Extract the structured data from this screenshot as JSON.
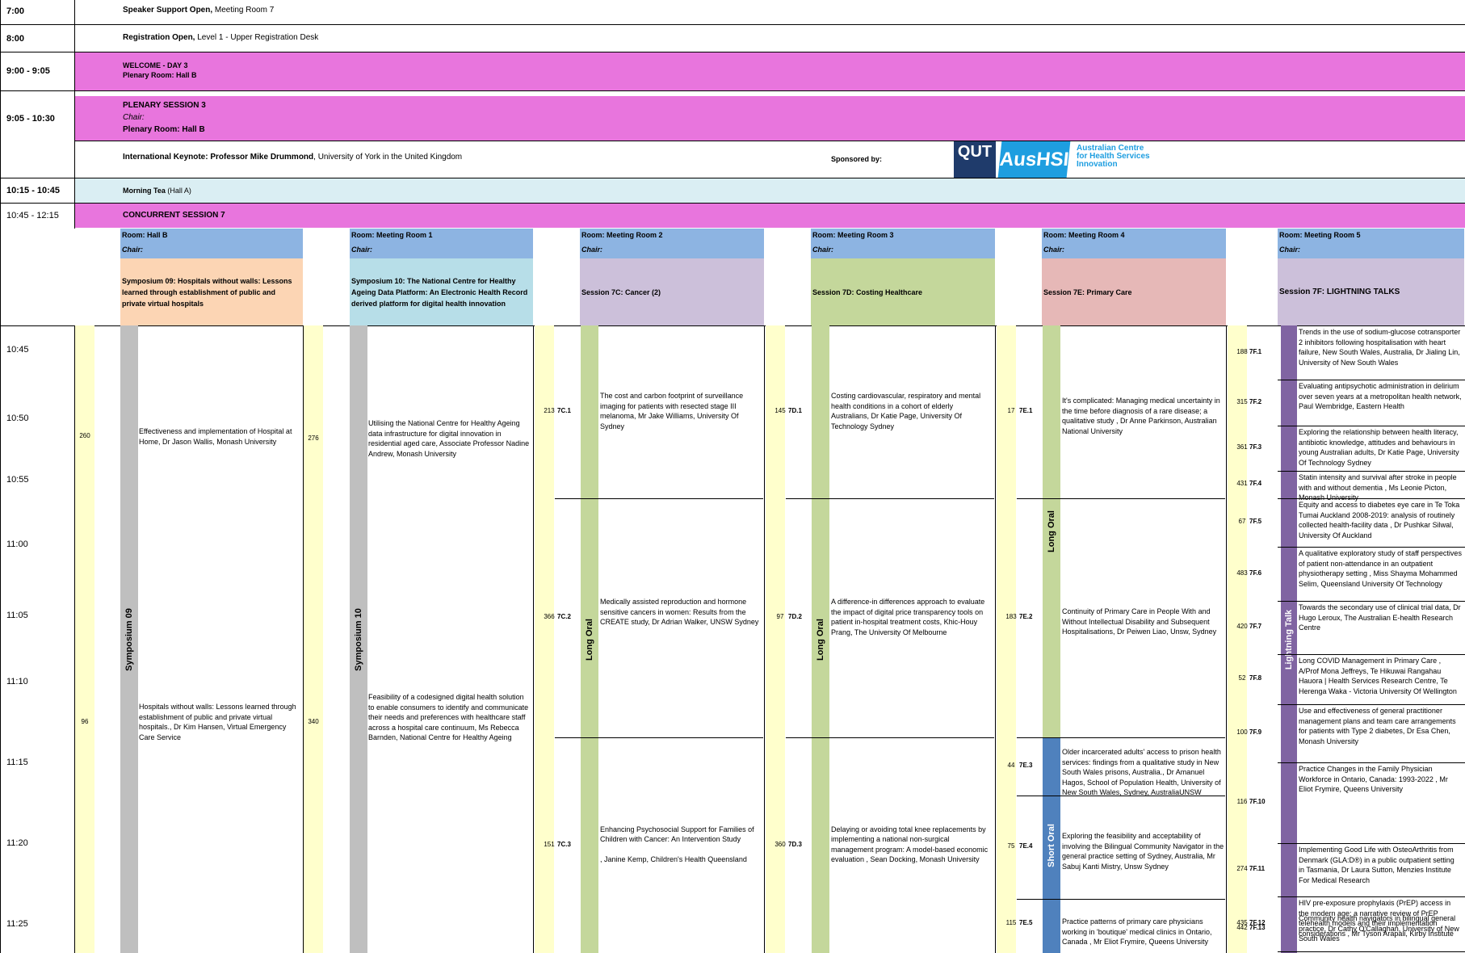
{
  "top_rows": [
    {
      "time": "7:00",
      "bold": "Speaker Support Open,",
      "rest": " Meeting Room 7"
    },
    {
      "time": "8:00",
      "bold": "Registration Open,",
      "rest": " Level 1 - Upper Registration Desk"
    }
  ],
  "welcome": {
    "time": "9:00 - 9:05",
    "line1": "WELCOME - DAY 3",
    "line2": "Plenary Room: Hall B"
  },
  "plenary": {
    "time": "9:05 - 10:30",
    "title": "PLENARY SESSION 3",
    "chair": "Chair:",
    "room": "Plenary Room: Hall B"
  },
  "keynote": {
    "bold": "International Keynote: Professor Mike Drummond",
    "rest": ", University of York in the United Kingdom",
    "sponsored": "Sponsored by:",
    "logo_qut": "QUT",
    "logo_ausxhsi": "AusHSI",
    "logo_text": [
      "Australian Centre",
      "for Health Services",
      "Innovation"
    ]
  },
  "morning_tea": {
    "time": "10:15 - 10:45",
    "bold": "Morning Tea",
    "rest": " (Hall A)"
  },
  "concurrent": {
    "time": "10:45 - 12:15",
    "title": "CONCURRENT SESSION 7"
  },
  "rooms": [
    {
      "room": "Room: Hall B",
      "chair": "Chair:",
      "session": "Symposium 09: Hospitals without walls: Lessons learned through establishment of public and private virtual hospitals",
      "color": "#fcd5b4"
    },
    {
      "room": "Room: Meeting Room 1",
      "chair": "Chair:",
      "session": "Symposium 10: The National Centre for Healthy Ageing Data Platform: An Electronic Health Record derived platform for digital health innovation",
      "color": "#b7dee8"
    },
    {
      "room": "Room: Meeting Room 2",
      "chair": "Chair:",
      "session": "Session 7C: Cancer (2)",
      "color": "#ccc0da"
    },
    {
      "room": "Room: Meeting Room 3",
      "chair": "Chair:",
      "session": "Session 7D: Costing Healthcare",
      "color": "#c4d79b"
    },
    {
      "room": "Room: Meeting Room 4",
      "chair": "Chair:",
      "session": "Session 7E: Primary Care",
      "color": "#e6b8b7"
    },
    {
      "room": "Room: Meeting Room 5",
      "chair": "Chair:",
      "session": "Session 7F: LIGHTNING TALKS",
      "color": "#ccc0da"
    }
  ],
  "room_header_color": "#8db4e2",
  "times": [
    "10:45",
    "10:50",
    "10:55",
    "11:00",
    "11:05",
    "11:10",
    "11:15",
    "11:20",
    "11:25"
  ],
  "vlabels": {
    "sym09": "Symposium 09",
    "sym10": "Symposium 10",
    "long_oral": "Long Oral",
    "short_oral": "Short Oral",
    "lightning": "Lightning Talk"
  },
  "sym09": [
    {
      "num": "260",
      "text": "Effectiveness and implementation of Hospital at Home, Dr Jason Wallis, Monash University"
    },
    {
      "num": "96",
      "text": "Hospitals without walls: Lessons learned through establishment of public and private virtual hospitals., Dr Kim Hansen, Virtual Emergency Care Service"
    }
  ],
  "sym10": [
    {
      "num": "276",
      "text": "Utilising the National Centre for Healthy Ageing data infrastructure for digital innovation in residential aged care, Associate Professor Nadine Andrew, Monash University"
    },
    {
      "num": "340",
      "text": "Feasibility of a codesigned digital health solution to enable consumers to identify and communicate their needs and preferences with healthcare staff across a hospital care continuum, Ms Rebecca Barnden, National Centre for Healthy Ageing"
    }
  ],
  "c7": [
    {
      "num": "213",
      "code": "7C.1",
      "text": "The cost and carbon footprint of surveillance imaging for patients with resected stage III melanoma, Mr Jake Williams, University Of Sydney"
    },
    {
      "num": "366",
      "code": "7C.2",
      "text": "Medically assisted reproduction and hormone sensitive cancers in women: Results from the CREATE study, Dr Adrian Walker, UNSW Sydney"
    },
    {
      "num": "151",
      "code": "7C.3",
      "text": "Enhancing Psychosocial Support for Families of Children with Cancer: An Intervention Study\n\n, Janine Kemp, Children's Health Queensland"
    }
  ],
  "d7": [
    {
      "num": "145",
      "code": "7D.1",
      "text": "Costing cardiovascular, respiratory and mental health conditions in a cohort of elderly Australians, Dr Katie Page, University Of Technology Sydney"
    },
    {
      "num": "97",
      "code": "7D.2",
      "text": "A difference-in differences approach to evaluate the impact of digital price transparency tools on patient in-hospital treatment costs, Khic-Houy Prang, The University Of Melbourne"
    },
    {
      "num": "360",
      "code": "7D.3",
      "text": "Delaying or avoiding total knee replacements by implementing a national non-surgical management program: A model-based economic evaluation ,  Sean Docking, Monash University"
    }
  ],
  "e7": [
    {
      "num": "17",
      "code": "7E.1",
      "text": "It's complicated: Managing medical uncertainty in the time before diagnosis of a rare disease; a qualitative study , Dr Anne Parkinson, Australian National University"
    },
    {
      "num": "183",
      "code": "7E.2",
      "text": "Continuity of Primary Care in People With and Without Intellectual Disability and Subsequent Hospitalisations, Dr Peiwen Liao, Unsw, Sydney"
    },
    {
      "num": "44",
      "code": "7E.3",
      "text": "Older incarcerated adults' access to prison health services: findings from a qualitative study in New South Wales prisons, Australia., Dr Amanuel Hagos, School of Population Health, University of New South Wales, Sydney, AustraliaUNSW"
    },
    {
      "num": "75",
      "code": "7E.4",
      "text": "Exploring the feasibility and acceptability of involving the Bilingual Community Navigator in the general practice setting of Sydney, Australia, Mr Sabuj Kanti Mistry, Unsw Sydney"
    },
    {
      "num": "115",
      "code": "7E.5",
      "text": "Practice patterns of primary care physicians working in 'boutique' medical clinics in Ontario, Canada , Mr Eliot Frymire, Queens University"
    }
  ],
  "f7": [
    {
      "num": "188",
      "code": "7F.1",
      "text": "Trends in the use of sodium-glucose cotransporter 2 inhibitors following hospitalisation with heart failure, New South Wales, Australia, Dr Jialing Lin, University of New South Wales"
    },
    {
      "num": "315",
      "code": "7F.2",
      "text": "Evaluating antipsychotic administration in delirium\nover seven years at a metropolitan health network,  Paul Wembridge, Eastern Health"
    },
    {
      "num": "361",
      "code": "7F.3",
      "text": "Exploring the relationship between health literacy, antibiotic knowledge, attitudes and behaviours in young Australian adults, Dr Katie Page, University Of Technology Sydney"
    },
    {
      "num": "431",
      "code": "7F.4",
      "text": "Statin intensity and survival after stroke in people with and without dementia , Ms Leonie Picton, Monash University"
    },
    {
      "num": "67",
      "code": "7F.5",
      "text": "Equity and access to diabetes eye care in Te Toka Tumai Auckland 2008-2019: analysis of routinely collected health-facility data , Dr Pushkar Silwal, University Of Auckland"
    },
    {
      "num": "483",
      "code": "7F.6",
      "text": "A qualitative exploratory study of staff perspectives of patient non-attendance in an outpatient physiotherapy setting , Miss Shayma Mohammed Selim, Queensland University Of Technology"
    },
    {
      "num": "420",
      "code": "7F.7",
      "text": "Towards the secondary use of clinical trial data, Dr Hugo Leroux, The Australian E-health Research Centre"
    },
    {
      "num": "52",
      "code": "7F.8",
      "text": "Long COVID Management in Primary Care , A/Prof Mona Jeffreys, Te Hikuwai Rangahau Hauora | Health Services Research Centre, Te Herenga Waka - Victoria University Of Wellington"
    },
    {
      "num": "100",
      "code": "7F.9",
      "text": "Use and effectiveness of general practitioner management plans and team care arrangements for patients with Type 2 diabetes, Dr Esa Chen, Monash University"
    },
    {
      "num": "116",
      "code": "7F.10",
      "text": "Practice Changes in the Family Physician Workforce in Ontario, Canada: 1993-2022 , Mr Eliot Frymire, Queens University"
    },
    {
      "num": "274",
      "code": "7F.11",
      "text": "Implementing Good Life with OsteoArthritis from Denmark (GLA:D®) in a public outpatient setting in Tasmania, Dr Laura Sutton, Menzies Institute For Medical Research"
    },
    {
      "num": "435",
      "code": "7F.12",
      "text": "HIV pre-exposure prophylaxis (PrEP) access in the modern age: a narrative review of PrEP telehealth models and their implementation considerations , Mr Tyson Arapali, Kirby Institute"
    },
    {
      "num": "442",
      "code": "7F.13",
      "text": "Community health navigators in bilingual general practice, Dr Cathy O'Callaghan, University of New South Wales"
    }
  ],
  "colors": {
    "magenta": "#e875dd",
    "light_blue": "#daeef3",
    "yellow": "#ffffcc",
    "gray": "#bfbfbf",
    "green": "#c4d79b",
    "purple": "#8064a2",
    "blue": "#4f81bd"
  }
}
